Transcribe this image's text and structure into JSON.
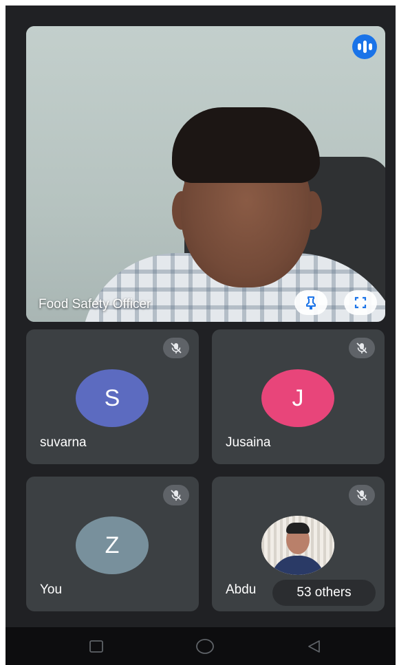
{
  "main_speaker": {
    "name": "Food Safety Officer",
    "speaking_indicator_icon": "audio-speaking-icon",
    "pin_icon": "pin-icon",
    "fullscreen_icon": "fullscreen-icon"
  },
  "participants": [
    {
      "name": "suvarna",
      "initial": "S",
      "avatar_color": "#5c6bc0",
      "muted": true
    },
    {
      "name": "Jusaina",
      "initial": "J",
      "avatar_color": "#e8457a",
      "muted": true
    },
    {
      "name": "You",
      "initial": "Z",
      "avatar_color": "#78909c",
      "muted": true
    },
    {
      "name": "Abdu",
      "initial": "",
      "avatar_color": "",
      "muted": true,
      "has_photo": true
    }
  ],
  "others_chip": {
    "label": "53 others"
  },
  "navbar": {
    "icons": [
      "recent-apps-icon",
      "home-icon",
      "back-icon"
    ]
  },
  "colors": {
    "background": "#202124",
    "tile": "#3c4043",
    "accent": "#1a73e8"
  }
}
